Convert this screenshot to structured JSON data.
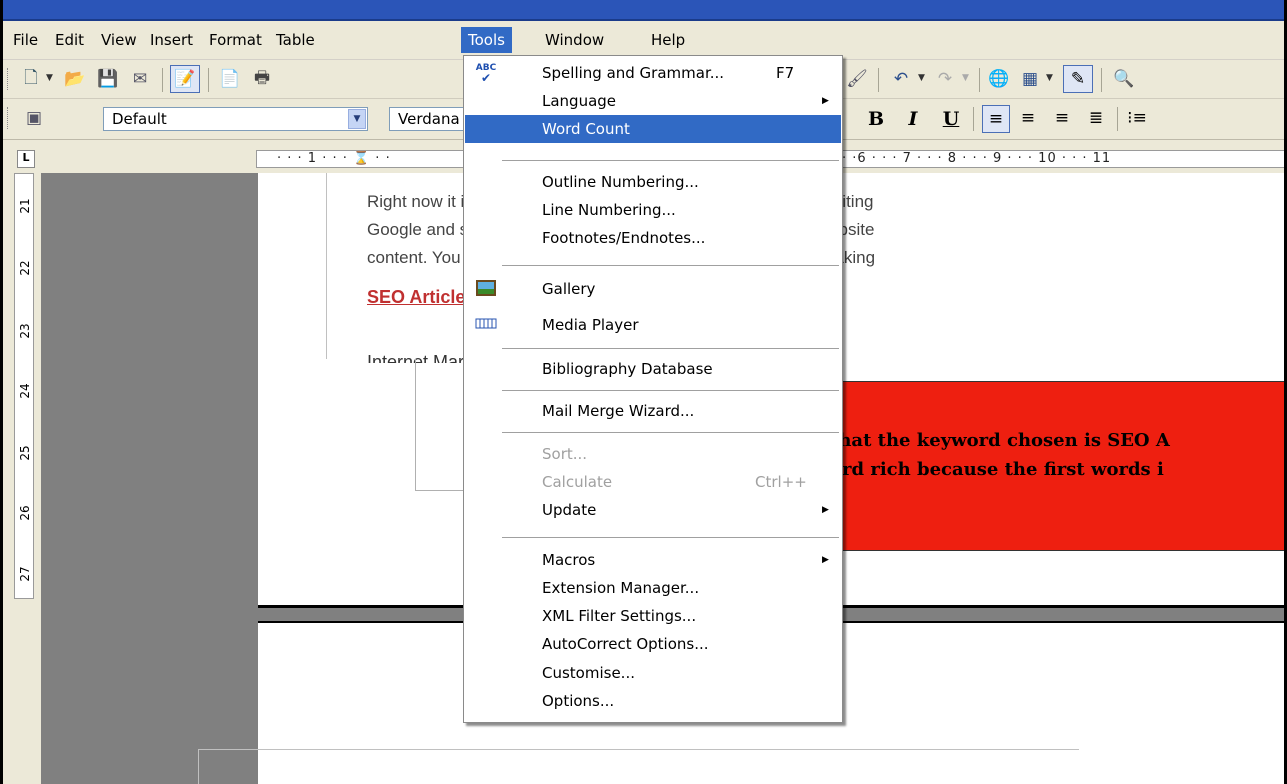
{
  "menubar": {
    "items": [
      {
        "label": "File"
      },
      {
        "label": "Edit"
      },
      {
        "label": "View"
      },
      {
        "label": "Insert"
      },
      {
        "label": "Format"
      },
      {
        "label": "Table"
      },
      {
        "label": "Tools"
      },
      {
        "label": "Window"
      },
      {
        "label": "Help"
      }
    ]
  },
  "format_toolbar": {
    "style_value": "Default",
    "font_value": "Verdana",
    "bold": "B",
    "italic": "I",
    "underline": "U"
  },
  "ruler": {
    "horizontal_left": "· · · 1 · · · ⌛ · ·",
    "horizontal_right": "· ·6 · · · 7 · · · 8 · · · 9 · · · 10 · · · 11",
    "vertical_numbers": [
      "21",
      "22",
      "23",
      "24",
      "25",
      "26",
      "27"
    ]
  },
  "document": {
    "para_line1": "Right now it is more useful in securing better page rank than writing",
    "para_line2": "Google and search engines will surely pay attention to your website",
    "para_line3": "content. You can write some effective SEO articles without breaking",
    "heading": "SEO Articles - 7 Simple But Powerful Steps to Get A",
    "cut_line": "Internet Marketing Article   -   Published: December 4, 2010",
    "red_line1": "that the keyword chosen is SEO A",
    "red_line2": "ord rich because the first words i"
  },
  "tools_menu": {
    "items": [
      {
        "label": "Spelling and Grammar...",
        "shortcut": "F7",
        "icon": "spellcheck-icon",
        "icon_text": "ABC"
      },
      {
        "label": "Language",
        "submenu": true
      },
      {
        "label": "Word Count",
        "highlighted": true
      },
      {
        "label": "Outline Numbering..."
      },
      {
        "label": "Line Numbering..."
      },
      {
        "label": "Footnotes/Endnotes..."
      },
      {
        "label": "Gallery",
        "icon": "gallery-icon"
      },
      {
        "label": "Media Player",
        "icon": "media-player-icon"
      },
      {
        "label": "Bibliography Database"
      },
      {
        "label": "Mail Merge Wizard..."
      },
      {
        "label": "Sort...",
        "disabled": true
      },
      {
        "label": "Calculate",
        "shortcut": "Ctrl++",
        "disabled": true
      },
      {
        "label": "Update",
        "submenu": true
      },
      {
        "label": "Macros",
        "submenu": true
      },
      {
        "label": "Extension Manager..."
      },
      {
        "label": "XML Filter Settings..."
      },
      {
        "label": "AutoCorrect Options..."
      },
      {
        "label": "Customise..."
      },
      {
        "label": "Options..."
      }
    ]
  },
  "colors": {
    "menu_highlight": "#316ac5",
    "chrome": "#ece9d8",
    "workspace": "#808080",
    "red_box": "#ee1f10",
    "heading_red": "#c03030"
  }
}
